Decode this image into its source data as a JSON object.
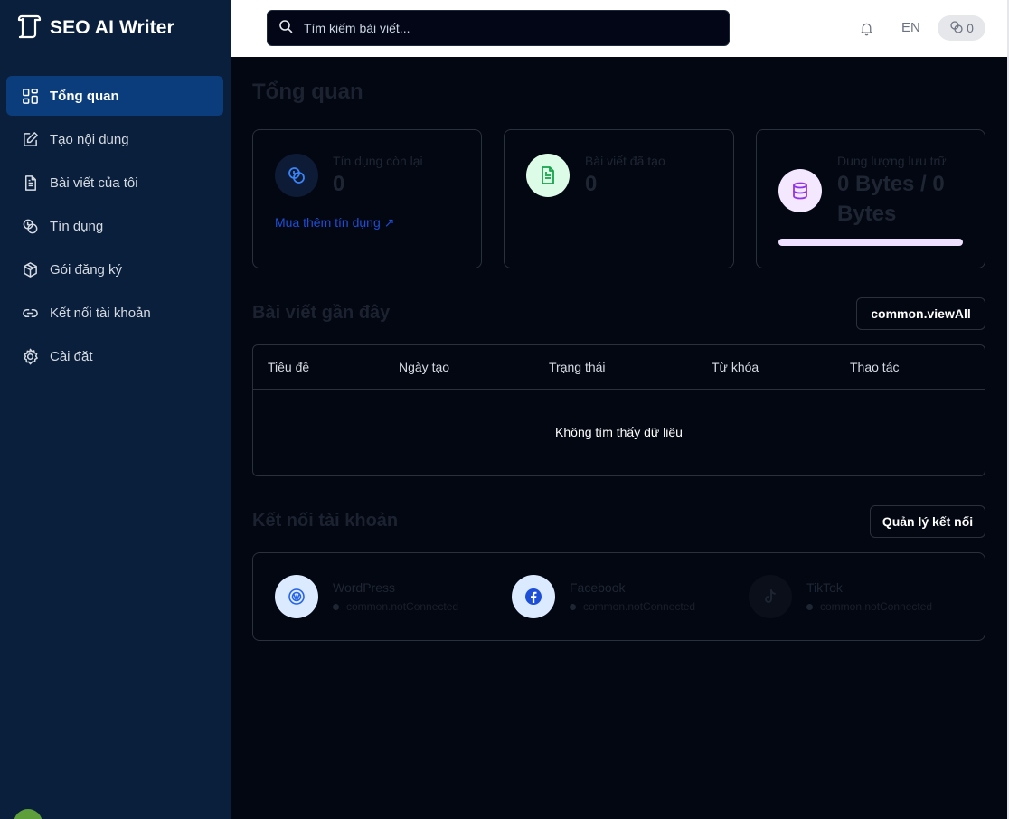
{
  "brand": {
    "title": "SEO AI Writer",
    "icon": "scroll-icon"
  },
  "sidebar": {
    "items": [
      {
        "label": "Tổng quan",
        "icon": "dashboard-grid-icon",
        "active": true
      },
      {
        "label": "Tạo nội dung",
        "icon": "edit-icon",
        "active": false
      },
      {
        "label": "Bài viết của tôi",
        "icon": "document-icon",
        "active": false
      },
      {
        "label": "Tín dụng",
        "icon": "coins-icon",
        "active": false
      },
      {
        "label": "Gói đăng ký",
        "icon": "package-icon",
        "active": false
      },
      {
        "label": "Kết nối tài khoản",
        "icon": "link-icon",
        "active": false
      },
      {
        "label": "Cài đặt",
        "icon": "gear-icon",
        "active": false
      }
    ]
  },
  "topbar": {
    "search_placeholder": "Tìm kiếm bài viết...",
    "language": "EN",
    "credits": "0"
  },
  "page": {
    "title": "Tổng quan"
  },
  "stats": {
    "credits": {
      "label": "Tín dụng còn lại",
      "value": "0",
      "link": "Mua thêm tín dụng ↗"
    },
    "articles": {
      "label": "Bài viết đã tạo",
      "value": "0"
    },
    "storage": {
      "label": "Dung lượng lưu trữ",
      "value_line1": "0 Bytes / 0",
      "value_line2": "Bytes",
      "usage_fraction": 1.0
    }
  },
  "recent": {
    "title": "Bài viết gần đây",
    "view_all": "common.viewAll",
    "columns": [
      "Tiêu đề",
      "Ngày tạo",
      "Trạng thái",
      "Từ khóa",
      "Thao tác"
    ],
    "empty": "Không tìm thấy dữ liệu"
  },
  "connections": {
    "title": "Kết nối tài khoản",
    "manage": "Quản lý kết nối",
    "items": [
      {
        "name": "WordPress",
        "status": "common.notConnected",
        "icon": "wordpress-icon"
      },
      {
        "name": "Facebook",
        "status": "common.notConnected",
        "icon": "facebook-icon"
      },
      {
        "name": "TikTok",
        "status": "common.notConnected",
        "icon": "tiktok-icon"
      }
    ]
  },
  "colors": {
    "sidebar_bg": "#0a1f3b",
    "active_item": "#0b3d7c",
    "main_bg": "#030712",
    "link_blue": "#1d4ed8",
    "storage_purple": "#f0e0ff",
    "article_green": "#dcfce7"
  }
}
